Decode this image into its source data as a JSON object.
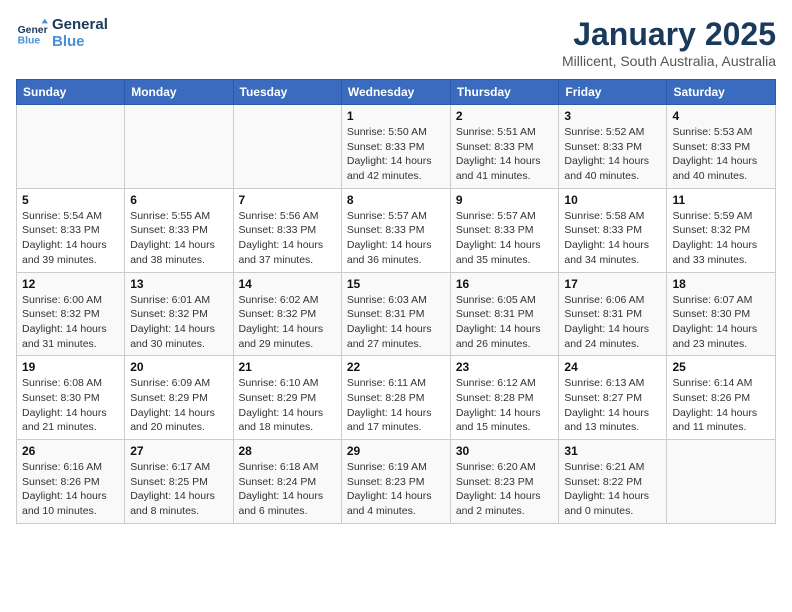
{
  "header": {
    "logo_line1": "General",
    "logo_line2": "Blue",
    "month": "January 2025",
    "location": "Millicent, South Australia, Australia"
  },
  "days_of_week": [
    "Sunday",
    "Monday",
    "Tuesday",
    "Wednesday",
    "Thursday",
    "Friday",
    "Saturday"
  ],
  "weeks": [
    [
      {
        "day": "",
        "info": ""
      },
      {
        "day": "",
        "info": ""
      },
      {
        "day": "",
        "info": ""
      },
      {
        "day": "1",
        "info": "Sunrise: 5:50 AM\nSunset: 8:33 PM\nDaylight: 14 hours\nand 42 minutes."
      },
      {
        "day": "2",
        "info": "Sunrise: 5:51 AM\nSunset: 8:33 PM\nDaylight: 14 hours\nand 41 minutes."
      },
      {
        "day": "3",
        "info": "Sunrise: 5:52 AM\nSunset: 8:33 PM\nDaylight: 14 hours\nand 40 minutes."
      },
      {
        "day": "4",
        "info": "Sunrise: 5:53 AM\nSunset: 8:33 PM\nDaylight: 14 hours\nand 40 minutes."
      }
    ],
    [
      {
        "day": "5",
        "info": "Sunrise: 5:54 AM\nSunset: 8:33 PM\nDaylight: 14 hours\nand 39 minutes."
      },
      {
        "day": "6",
        "info": "Sunrise: 5:55 AM\nSunset: 8:33 PM\nDaylight: 14 hours\nand 38 minutes."
      },
      {
        "day": "7",
        "info": "Sunrise: 5:56 AM\nSunset: 8:33 PM\nDaylight: 14 hours\nand 37 minutes."
      },
      {
        "day": "8",
        "info": "Sunrise: 5:57 AM\nSunset: 8:33 PM\nDaylight: 14 hours\nand 36 minutes."
      },
      {
        "day": "9",
        "info": "Sunrise: 5:57 AM\nSunset: 8:33 PM\nDaylight: 14 hours\nand 35 minutes."
      },
      {
        "day": "10",
        "info": "Sunrise: 5:58 AM\nSunset: 8:33 PM\nDaylight: 14 hours\nand 34 minutes."
      },
      {
        "day": "11",
        "info": "Sunrise: 5:59 AM\nSunset: 8:32 PM\nDaylight: 14 hours\nand 33 minutes."
      }
    ],
    [
      {
        "day": "12",
        "info": "Sunrise: 6:00 AM\nSunset: 8:32 PM\nDaylight: 14 hours\nand 31 minutes."
      },
      {
        "day": "13",
        "info": "Sunrise: 6:01 AM\nSunset: 8:32 PM\nDaylight: 14 hours\nand 30 minutes."
      },
      {
        "day": "14",
        "info": "Sunrise: 6:02 AM\nSunset: 8:32 PM\nDaylight: 14 hours\nand 29 minutes."
      },
      {
        "day": "15",
        "info": "Sunrise: 6:03 AM\nSunset: 8:31 PM\nDaylight: 14 hours\nand 27 minutes."
      },
      {
        "day": "16",
        "info": "Sunrise: 6:05 AM\nSunset: 8:31 PM\nDaylight: 14 hours\nand 26 minutes."
      },
      {
        "day": "17",
        "info": "Sunrise: 6:06 AM\nSunset: 8:31 PM\nDaylight: 14 hours\nand 24 minutes."
      },
      {
        "day": "18",
        "info": "Sunrise: 6:07 AM\nSunset: 8:30 PM\nDaylight: 14 hours\nand 23 minutes."
      }
    ],
    [
      {
        "day": "19",
        "info": "Sunrise: 6:08 AM\nSunset: 8:30 PM\nDaylight: 14 hours\nand 21 minutes."
      },
      {
        "day": "20",
        "info": "Sunrise: 6:09 AM\nSunset: 8:29 PM\nDaylight: 14 hours\nand 20 minutes."
      },
      {
        "day": "21",
        "info": "Sunrise: 6:10 AM\nSunset: 8:29 PM\nDaylight: 14 hours\nand 18 minutes."
      },
      {
        "day": "22",
        "info": "Sunrise: 6:11 AM\nSunset: 8:28 PM\nDaylight: 14 hours\nand 17 minutes."
      },
      {
        "day": "23",
        "info": "Sunrise: 6:12 AM\nSunset: 8:28 PM\nDaylight: 14 hours\nand 15 minutes."
      },
      {
        "day": "24",
        "info": "Sunrise: 6:13 AM\nSunset: 8:27 PM\nDaylight: 14 hours\nand 13 minutes."
      },
      {
        "day": "25",
        "info": "Sunrise: 6:14 AM\nSunset: 8:26 PM\nDaylight: 14 hours\nand 11 minutes."
      }
    ],
    [
      {
        "day": "26",
        "info": "Sunrise: 6:16 AM\nSunset: 8:26 PM\nDaylight: 14 hours\nand 10 minutes."
      },
      {
        "day": "27",
        "info": "Sunrise: 6:17 AM\nSunset: 8:25 PM\nDaylight: 14 hours\nand 8 minutes."
      },
      {
        "day": "28",
        "info": "Sunrise: 6:18 AM\nSunset: 8:24 PM\nDaylight: 14 hours\nand 6 minutes."
      },
      {
        "day": "29",
        "info": "Sunrise: 6:19 AM\nSunset: 8:23 PM\nDaylight: 14 hours\nand 4 minutes."
      },
      {
        "day": "30",
        "info": "Sunrise: 6:20 AM\nSunset: 8:23 PM\nDaylight: 14 hours\nand 2 minutes."
      },
      {
        "day": "31",
        "info": "Sunrise: 6:21 AM\nSunset: 8:22 PM\nDaylight: 14 hours\nand 0 minutes."
      },
      {
        "day": "",
        "info": ""
      }
    ]
  ]
}
